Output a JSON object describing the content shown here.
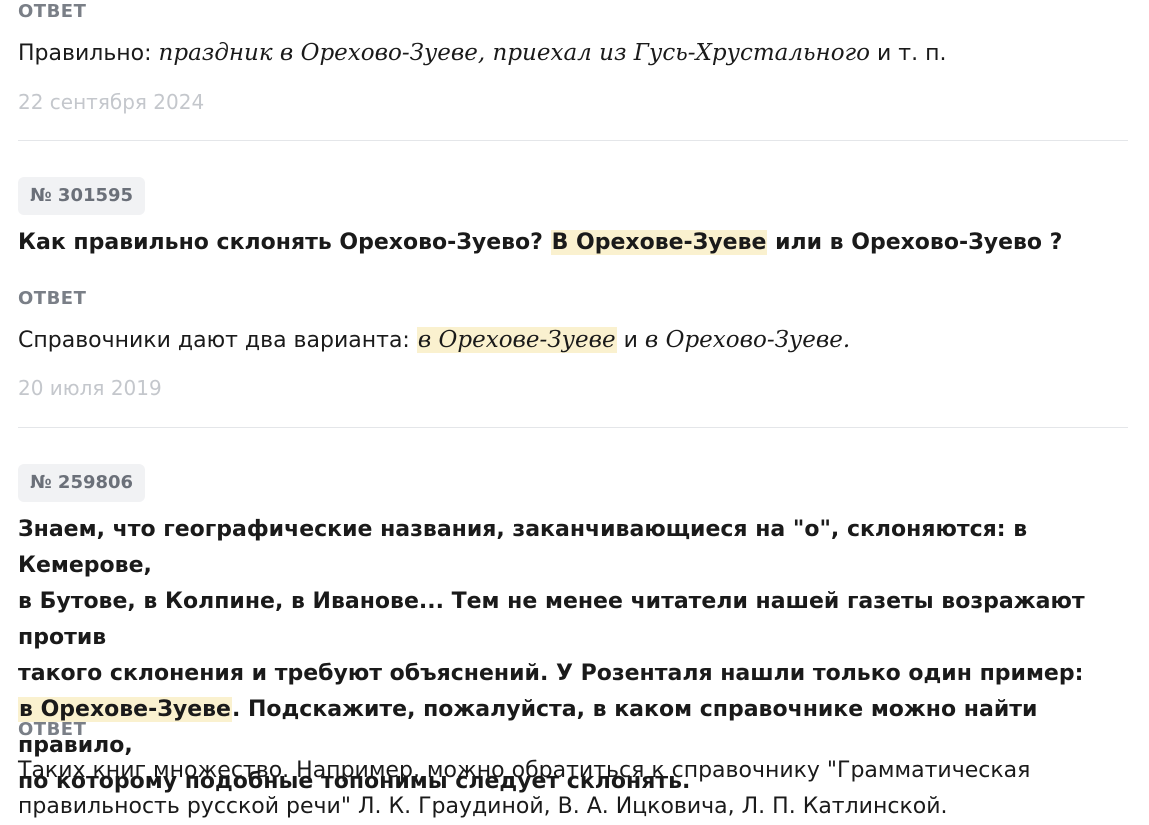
{
  "label_answer": "ОТВЕТ",
  "entry0": {
    "answer_prefix": "Правильно: ",
    "answer_italic": "праздник в Орехово-Зуеве, приехал из Гусь-Хрустального",
    "answer_suffix": " и т. п.",
    "date": "22 сентября 2024"
  },
  "entry1": {
    "number": "№ 301595",
    "question_a": "Как правильно склонять Орехово-Зуево? ",
    "question_hl": "В Орехове-Зуеве",
    "question_b": " или в Орехово-Зуево ?",
    "answer_prefix": "Справочники дают два варианта: ",
    "answer_hl_italic": "в Орехове-Зуеве",
    "answer_mid": " и ",
    "answer_italic": "в Орехово-Зуеве.",
    "date": "20 июля 2019"
  },
  "entry2": {
    "number": "№ 259806",
    "question_line1": "Знаем, что географические названия, заканчивающиеся на \"о\", склоняются: в Кемерове,",
    "question_line2": "в Бутове, в Колпине, в Иванове... Тем не менее читатели нашей газеты возражают против",
    "question_line3": "такого склонения и требуют объяснений. У Розенталя нашли только один пример:",
    "question_line4_hl": "в Орехове-Зуеве",
    "question_line4_rest": ". Подскажите, пожалуйста, в каком справочнике можно найти правило,",
    "question_line5": "по которому подобные топонимы следует склонять.",
    "answer_line1": "Таких книг множество. Например, можно обратиться к справочнику \"Грамматическая",
    "answer_line2": "правильность русской речи\" Л. К. Граудиной, В. А. Ицковича, Л. П. Катлинской."
  }
}
